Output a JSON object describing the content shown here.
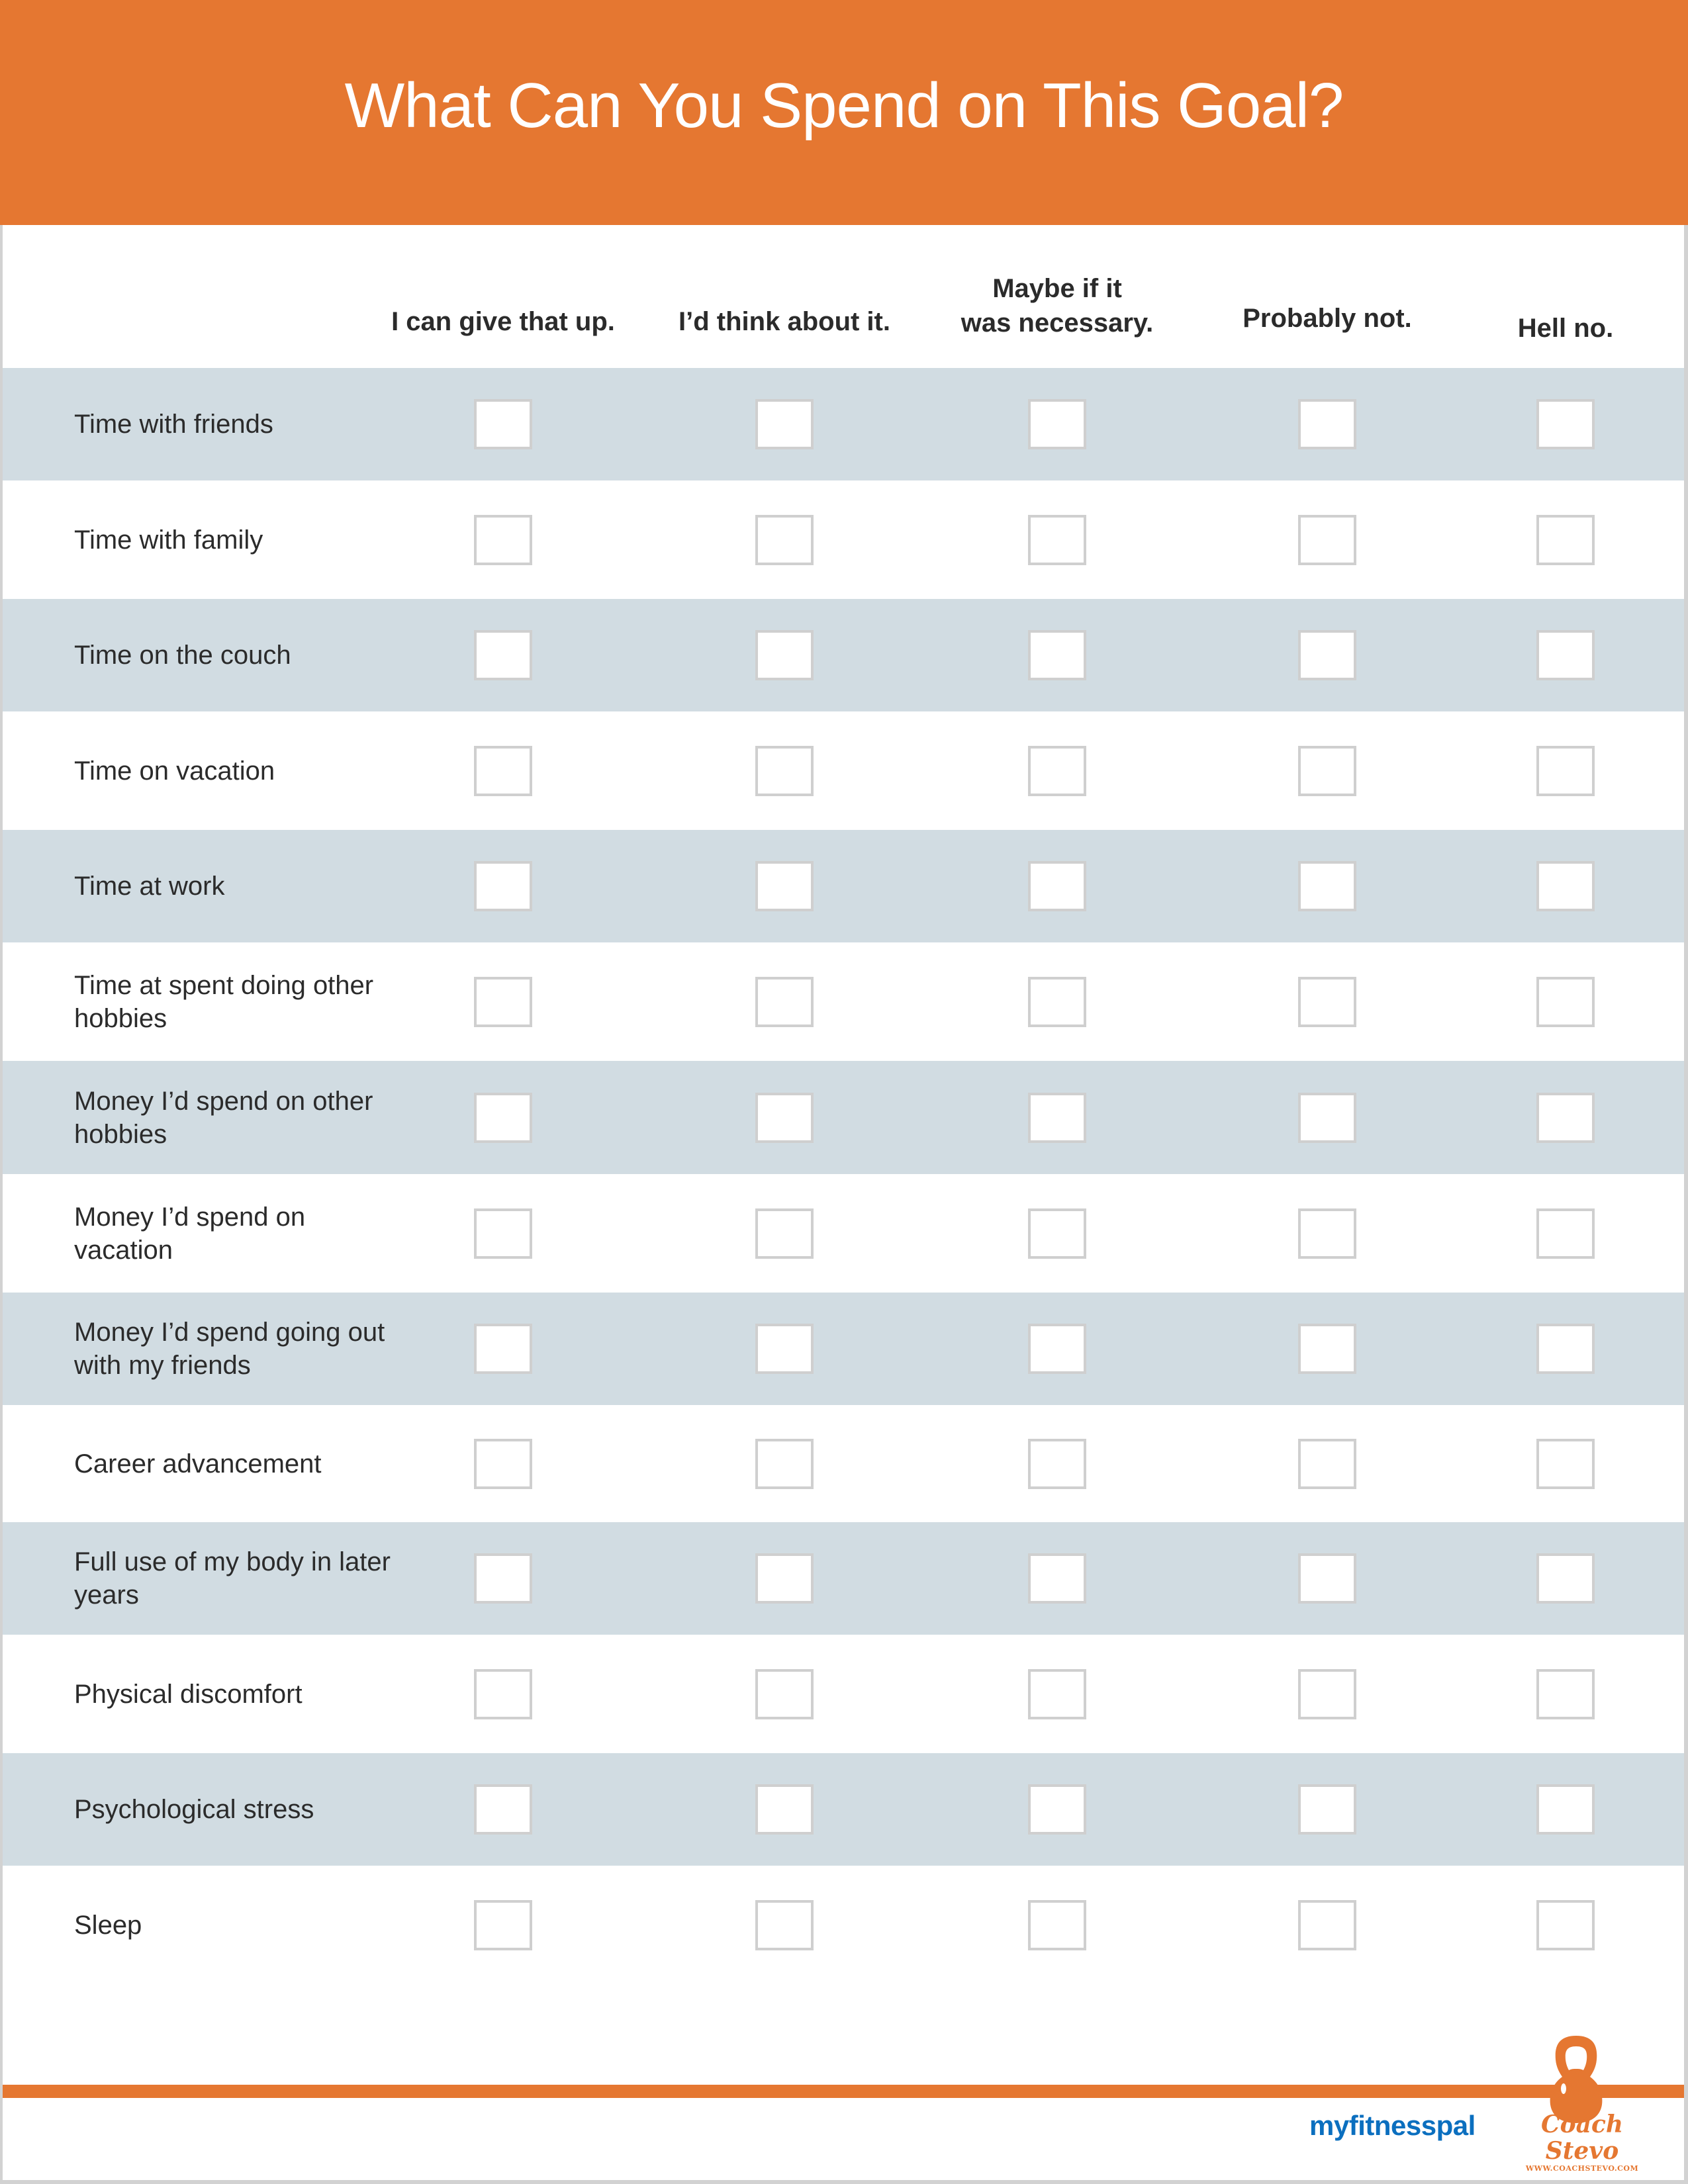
{
  "title": "What Can You Spend on This Goal?",
  "columns": [
    "I can give that up.",
    "I’d think about it.",
    "Maybe if it\nwas necessary.",
    "Probably not.",
    "Hell no."
  ],
  "rows": [
    {
      "label": "Time with friends",
      "checked": [
        false,
        false,
        false,
        false,
        false
      ]
    },
    {
      "label": "Time with family",
      "checked": [
        false,
        false,
        false,
        false,
        false
      ]
    },
    {
      "label": "Time on the couch",
      "checked": [
        false,
        false,
        false,
        false,
        false
      ]
    },
    {
      "label": "Time on vacation",
      "checked": [
        false,
        false,
        false,
        false,
        false
      ]
    },
    {
      "label": "Time at work",
      "checked": [
        false,
        false,
        false,
        false,
        false
      ]
    },
    {
      "label": "Time at spent doing other hobbies",
      "checked": [
        false,
        false,
        false,
        false,
        false
      ]
    },
    {
      "label": "Money I’d spend on other hobbies",
      "checked": [
        false,
        false,
        false,
        false,
        false
      ]
    },
    {
      "label": "Money I’d spend on vacation",
      "checked": [
        false,
        false,
        false,
        false,
        false
      ]
    },
    {
      "label": "Money I’d spend going out with my friends",
      "checked": [
        false,
        false,
        false,
        false,
        false
      ]
    },
    {
      "label": "Career advancement",
      "checked": [
        false,
        false,
        false,
        false,
        false
      ]
    },
    {
      "label": "Full use of my body in later years",
      "checked": [
        false,
        false,
        false,
        false,
        false
      ]
    },
    {
      "label": "Physical discomfort",
      "checked": [
        false,
        false,
        false,
        false,
        false
      ]
    },
    {
      "label": "Psychological stress",
      "checked": [
        false,
        false,
        false,
        false,
        false
      ]
    },
    {
      "label": "Sleep",
      "checked": [
        false,
        false,
        false,
        false,
        false
      ]
    }
  ],
  "footer": {
    "logo_left": "myfitnesspal",
    "logo_right_name": "Coach Stevo",
    "logo_right_url": "WWW.COACHSTEVO.COM",
    "logo_right_icon": "kettlebell-icon"
  },
  "colors": {
    "accent": "#e57731",
    "row_shade": "#d1dce2",
    "brand_blue": "#0b6fbf"
  }
}
